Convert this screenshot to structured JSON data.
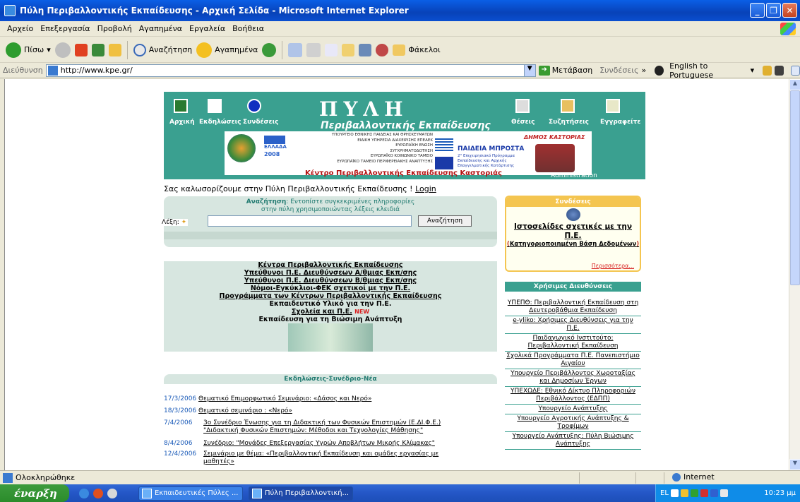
{
  "window": {
    "title": "Πύλη Περιβαλλοντικής Εκπαίδευσης - Αρχική Σελίδα - Microsoft Internet Explorer",
    "minimize": "_",
    "maximize": "❐",
    "close": "✕"
  },
  "menu": [
    "Αρχείο",
    "Επεξεργασία",
    "Προβολή",
    "Αγαπημένα",
    "Εργαλεία",
    "Βοήθεια"
  ],
  "toolbar": {
    "back": "Πίσω",
    "search": "Αναζήτηση",
    "favorites": "Αγαπημένα",
    "folders": "Φάκελοι"
  },
  "addressbar": {
    "label": "Διεύθυνση",
    "url": "http://www.kpe.gr/",
    "go": "Μετάβαση",
    "links": "Συνδέσεις",
    "translate": "English to Portuguese"
  },
  "page": {
    "banner": {
      "logo_title": "ΠΥΛΗ",
      "subtitle": "Περιβαλλοντικής Εκπαίδευσης",
      "nav_left": [
        "Αρχική",
        "Εκδηλώσεις",
        "Συνδέσεις"
      ],
      "nav_right": [
        "Θέσεις",
        "Συζητήσεις",
        "Εγγραφείτε"
      ],
      "ministry_lines": [
        "ΥΠΟΥΡΓΕΙΟ ΕΘΝΙΚΗΣ ΠΑΙΔΕΙΑΣ ΚΑΙ ΘΡΗΣΚΕΥΜΑΤΩΝ",
        "ΕΙΔΙΚΗ ΥΠΗΡΕΣΙΑ ΔΙΑΧΕΙΡΙΣΗΣ ΕΠΕΑΕΚ",
        "ΕΥΡΩΠΑΪΚΗ ΕΝΩΣΗ",
        "ΣΥΓΧΡΗΜΑΤΟΔΟΤΗΣΗ",
        "ΕΥΡΩΠΑΪΚΟ ΚΟΙΝΩΝΙΚΟ ΤΑΜΕΙΟ",
        "ΕΥΡΩΠΑΪΚΟ ΤΑΜΕΙΟ ΠΕΡΙΦΕΡΕΙΑΚΗΣ ΑΝΑΠΤΥΞΗΣ"
      ],
      "paideia": "ΠΑΙΔΕΙΑ ΜΠΡΟΣΤΑ",
      "paideia_sub": [
        "2° Επιχειρησιακό Πρόγραμμα",
        "Εκπαίδευσης και Αρχικής",
        "Επαγγελματικής Κατάρτισης"
      ],
      "dimos": "ΔΗΜΟΣ ΚΑΣΤΟΡΙΑΣ",
      "ellada": "ΕΛΛΑΔΑ",
      "year": "2008",
      "credit": "Κέντρο Περιβαλλοντικής Εκπαίδευσης Καστοριάς",
      "admin": "Administration"
    },
    "welcome_text": "Σας καλωσορίζουμε στην Πύλη Περιβαλλοντικής Εκπαίδευσης !",
    "login": "Login",
    "search": {
      "hint_bold": "Αναζήτηση",
      "hint_rest": ": Εντοπίστε συγκεκριμένες πληροφορίες",
      "hint_line2": "στην πύλη χρησιμοποιώντας λέξεις κλειδιά",
      "label": "Λέξη:",
      "button": "Αναζήτηση"
    },
    "main_links": [
      "Κέντρα Περιβαλλοντικής Εκπαίδευσης",
      "Υπεύθυνοι Π.Ε. Διευθύνσεων Α/θμιας Εκπ/σης",
      "Υπεύθυνοι Π.Ε. Διευθύνσεων Β/θμιας Εκπ/σης",
      "Νόμοι-Εγκύκλιοι-ΦΕΚ σχετικοί με την Π.Ε.",
      "Προγράμματα των Κέντρων Περιβαλλοντικής Εκπαίδευσης",
      "Εκπαιδευτικό Υλικό για την Π.Ε.",
      "Σχολεία και Π.Ε.",
      "Εκπαίδευση για τη Βιώσιμη Ανάπτυξη"
    ],
    "new_tag": "NEW",
    "news": {
      "header": "Εκδηλώσεις-Συνέδριο-Νέα",
      "items": [
        {
          "date": "17/3/2006",
          "text": "Θεματικό Επιμορφωτικό Σεμινάριο: «Δάσος και Νερό»"
        },
        {
          "date": "18/3/2006",
          "text": "Θεματικό σεμινάριο : «Νερό»"
        },
        {
          "date": "7/4/2006",
          "text": "3ο Συνέδριο Ένωσης για τη Διδακτική των Φυσικών Επιστημών (Ε.ΔΙ.Φ.Ε.)",
          "text2": "\"Διδακτική Φυσικών Επιστημών: Μέθοδοι και Τεχνολογίες Μάθησης\""
        },
        {
          "date": "8/4/2006",
          "text": "Συνέδριο: \"Μονάδες Επεξεργασίας Υγρών Αποβλήτων Μικρής Κλίμακας\""
        },
        {
          "date": "12/4/2006",
          "text": "Σεμινάριο με θέμα: «Περιβαλλοντική Εκπαίδευση και ομάδες εργασίας με",
          "text2": "μαθητές»"
        }
      ]
    },
    "syndeseis": {
      "header": "Συνδέσεις",
      "title": "Ιστοσελίδες σχετικές με την Π.Ε.",
      "paren_open": "(",
      "category": "Κατηγοριοποιημένη Βάση Δεδομένων",
      "paren_close": ")",
      "more": "Περισσότερα..."
    },
    "useful": {
      "header": "Χρήσιμες Διευθύνσεις",
      "links": [
        "ΥΠΕΠΘ: Περιβαλλοντική Εκπαίδευση στη Δευτεροβάθμια Εκπαίδευση",
        "e-yliko: Χρήσιμες Διευθύνσεις για την Π.Ε.",
        "Παιδαγωγικό Ινστιτούτο: Περιβαλλοντική Εκπαίδευση",
        "Σχολικά Προγράμματα Π.Ε. Πανεπιστήμιο Αιγαίου",
        "Υπουργείο Περιβάλλοντος Χωροταξίας και Δημοσίων Έργων",
        "ΥΠΕΧΩΔΕ: Εθνικό Δίκτυο Πληροφοριών Περιβάλλοντος (ΕΔΠΠ)",
        "Υπουργείο Ανάπτυξης",
        "Υπουργείο Αγροτικής Ανάπτυξης & Τροφίμων",
        "Υπουργείο Ανάπτυξης: Πύλη Βιώσιμης Ανάπτυξης"
      ]
    }
  },
  "status": {
    "text": "Ολοκληρώθηκε",
    "zone": "Internet"
  },
  "taskbar": {
    "start": "έναρξη",
    "tasks": [
      "Εκπαιδευτικές Πύλες ...",
      "Πύλη Περιβαλλοντική..."
    ],
    "lang": "EL",
    "clock": "10:23 μμ"
  }
}
